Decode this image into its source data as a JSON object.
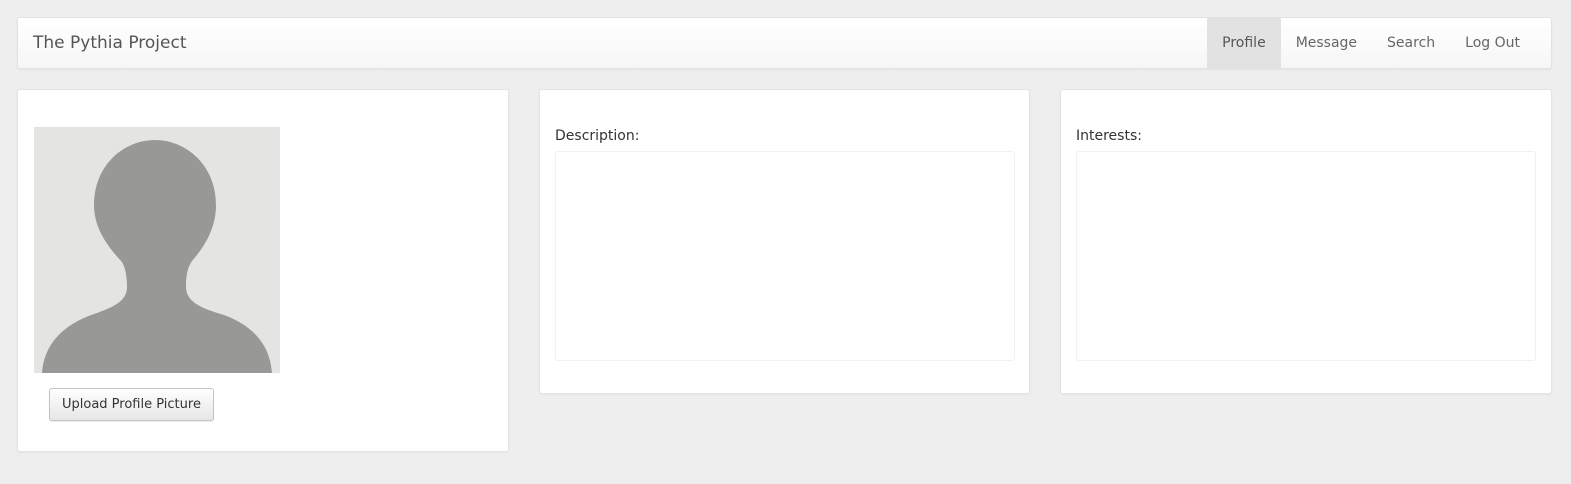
{
  "navbar": {
    "brand": "The Pythia Project",
    "items": [
      {
        "label": "Profile",
        "active": true
      },
      {
        "label": "Message",
        "active": false
      },
      {
        "label": "Search",
        "active": false
      },
      {
        "label": "Log Out",
        "active": false
      }
    ]
  },
  "profile": {
    "avatar_icon": "default-user-silhouette",
    "upload_button_label": "Upload Profile Picture"
  },
  "description": {
    "label": "Description:",
    "value": ""
  },
  "interests": {
    "label": "Interests:",
    "value": ""
  },
  "colors": {
    "background": "#eeeeee",
    "active_nav": "#e2e2e2",
    "avatar_bg": "#e4e5e3",
    "avatar_silhouette": "#989996"
  }
}
